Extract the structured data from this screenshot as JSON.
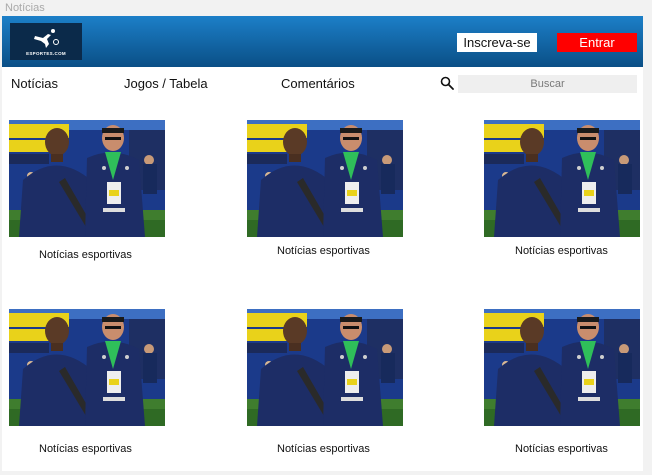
{
  "page": {
    "label": "Notícias"
  },
  "header": {
    "logo_text": "ESPORTES.COM",
    "subscribe_label": "Inscreva-se",
    "login_label": "Entrar",
    "gradient_top": "#1c7fc8",
    "gradient_bottom": "#0a4f86",
    "login_color": "#ff0000"
  },
  "nav": {
    "items": [
      {
        "label": "Notícias"
      },
      {
        "label": "Jogos / Tabela"
      },
      {
        "label": "Comentários"
      }
    ],
    "search_icon": "search-icon",
    "search_placeholder": "Buscar"
  },
  "news": [
    {
      "caption": "Notícias esportivas"
    },
    {
      "caption": "Notícias esportivas"
    },
    {
      "caption": "Notícias esportivas"
    },
    {
      "caption": "Notícias esportivas"
    },
    {
      "caption": "Notícias esportivas"
    },
    {
      "caption": "Notícias esportivas"
    }
  ]
}
